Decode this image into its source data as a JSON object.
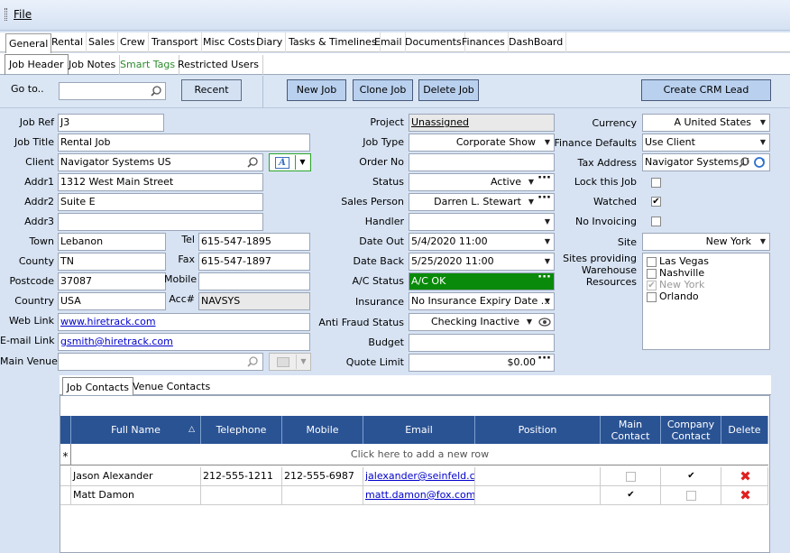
{
  "menu": {
    "file": "File"
  },
  "main_tabs": [
    "General",
    "Rental",
    "Sales",
    "Crew",
    "Transport",
    "Misc Costs",
    "Diary",
    "Tasks  & Timelines",
    "Email",
    "Documents",
    "Finances",
    "DashBoard"
  ],
  "sub_tabs": [
    "Job Header",
    "Job Notes",
    "Smart Tags",
    "Restricted Users"
  ],
  "toolbar": {
    "goto_label": "Go to..",
    "goto_value": "",
    "recent": "Recent",
    "new_job": "New Job",
    "clone_job": "Clone Job",
    "delete_job": "Delete Job",
    "create_crm": "Create CRM Lead"
  },
  "left": {
    "job_ref": {
      "label": "Job Ref",
      "value": "J3"
    },
    "job_title": {
      "label": "Job Title",
      "value": "Rental Job"
    },
    "client": {
      "label": "Client",
      "value": "Navigator Systems US"
    },
    "addr1": {
      "label": "Addr1",
      "value": "1312 West Main Street"
    },
    "addr2": {
      "label": "Addr2",
      "value": "Suite E"
    },
    "addr3": {
      "label": "Addr3",
      "value": ""
    },
    "town": {
      "label": "Town",
      "value": "Lebanon"
    },
    "tel": {
      "label": "Tel",
      "value": "615-547-1895"
    },
    "county": {
      "label": "County",
      "value": "TN"
    },
    "fax": {
      "label": "Fax",
      "value": "615-547-1897"
    },
    "postcode": {
      "label": "Postcode",
      "value": "37087"
    },
    "mobile": {
      "label": "Mobile",
      "value": ""
    },
    "country": {
      "label": "Country",
      "value": "USA"
    },
    "acc": {
      "label": "Acc#",
      "value": "NAVSYS"
    },
    "web_link": {
      "label": "Web Link",
      "value": "www.hiretrack.com"
    },
    "email_link": {
      "label": "E-mail Link",
      "value": "gsmith@hiretrack.com"
    },
    "main_venue": {
      "label": "Main Venue",
      "value": ""
    }
  },
  "middle": {
    "project": {
      "label": "Project",
      "value": "Unassigned"
    },
    "job_type": {
      "label": "Job Type",
      "value": "Corporate Show"
    },
    "order_no": {
      "label": "Order No",
      "value": ""
    },
    "status": {
      "label": "Status",
      "value": "Active"
    },
    "sales_person": {
      "label": "Sales Person",
      "value": "Darren L. Stewart"
    },
    "handler": {
      "label": "Handler",
      "value": ""
    },
    "date_out": {
      "label": "Date Out",
      "value": "5/4/2020 11:00"
    },
    "date_back": {
      "label": "Date Back",
      "value": "5/25/2020 11:00"
    },
    "ac_status": {
      "label": "A/C Status",
      "value": "A/C OK"
    },
    "insurance": {
      "label": "Insurance",
      "value": "No Insurance Expiry Date ..."
    },
    "anti_fraud": {
      "label": "Anti Fraud Status",
      "value": "Checking Inactive"
    },
    "budget": {
      "label": "Budget",
      "value": ""
    },
    "quote_limit": {
      "label": "Quote Limit",
      "value": "$0.00"
    }
  },
  "right": {
    "currency": {
      "label": "Currency",
      "value": "A United States"
    },
    "finance_defaults": {
      "label": "Finance Defaults",
      "value": "Use Client"
    },
    "tax_address": {
      "label": "Tax Address",
      "value": "Navigator Systems U"
    },
    "lock_job": {
      "label": "Lock this Job",
      "checked": false
    },
    "watched": {
      "label": "Watched",
      "checked": true
    },
    "no_invoicing": {
      "label": "No Invoicing",
      "checked": false
    },
    "site": {
      "label": "Site",
      "value": "New York"
    },
    "sites_label": "Sites providing Warehouse Resources",
    "sites_label_lines": [
      "Sites providing",
      "Warehouse",
      "Resources"
    ],
    "sites": [
      {
        "name": "Las Vegas",
        "checked": false,
        "disabled": false
      },
      {
        "name": "Nashville",
        "checked": false,
        "disabled": false
      },
      {
        "name": "New York",
        "checked": true,
        "disabled": true
      },
      {
        "name": "Orlando",
        "checked": false,
        "disabled": false
      }
    ]
  },
  "contacts": {
    "tabs": [
      "Job Contacts",
      "Venue Contacts"
    ],
    "columns": [
      "Full Name",
      "Telephone",
      "Mobile",
      "Email",
      "Position",
      "Main Contact",
      "Company Contact",
      "Delete"
    ],
    "add_row": "Click here to add a new row",
    "new_row_marker": "*",
    "sort_glyph": "△",
    "rows": [
      {
        "name": "Jason Alexander",
        "telephone": "212-555-1211",
        "mobile": "212-555-6987",
        "email": "jalexander@seinfeld.com",
        "position": "",
        "main_contact": false,
        "company_contact": true
      },
      {
        "name": "Matt Damon",
        "telephone": "",
        "mobile": "",
        "email": "matt.damon@fox.com",
        "position": "",
        "main_contact": true,
        "company_contact": false
      }
    ]
  }
}
